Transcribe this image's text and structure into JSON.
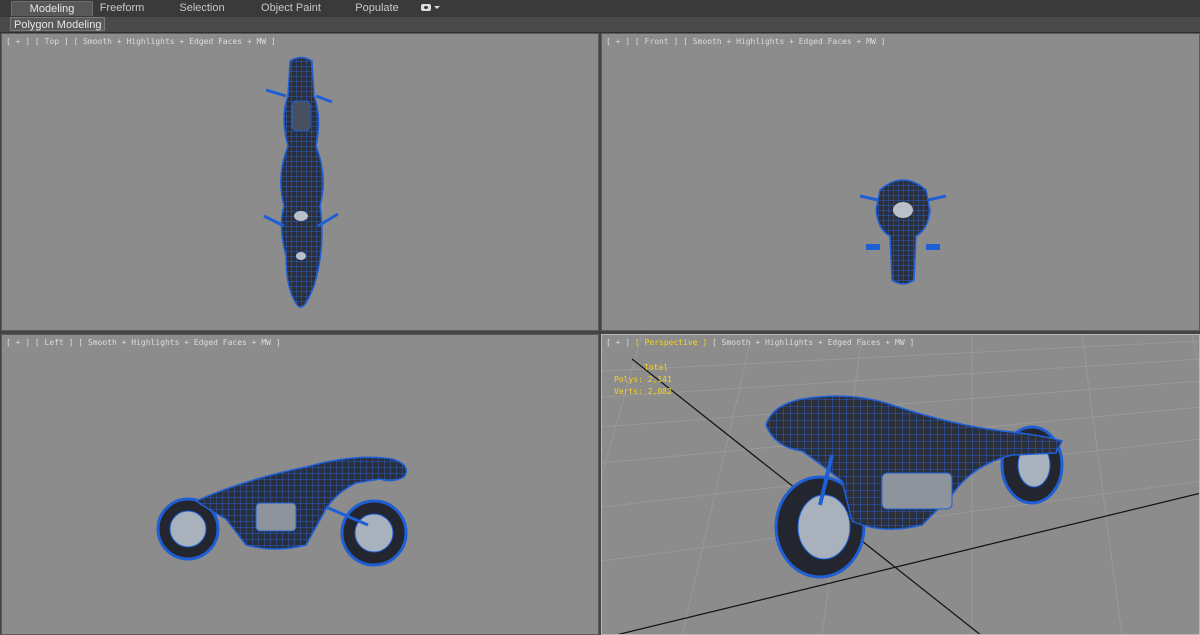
{
  "ribbon": {
    "tabs": [
      {
        "label": "Modeling",
        "active": true
      },
      {
        "label": "Freeform",
        "active": false
      },
      {
        "label": "Selection",
        "active": false
      },
      {
        "label": "Object Paint",
        "active": false
      },
      {
        "label": "Populate",
        "active": false
      }
    ],
    "options_icon": "camera-dropdown-icon",
    "panel_label": "Polygon Modeling"
  },
  "viewports": {
    "top": {
      "plus": "[ + ]",
      "name": "[ Top ]",
      "shading": "[ Smooth + Highlights + Edged Faces + MW ]"
    },
    "front": {
      "plus": "[ + ]",
      "name": "[ Front ]",
      "shading": "[ Smooth + Highlights + Edged Faces + MW ]"
    },
    "left": {
      "plus": "[ + ]",
      "name": "[ Left ]",
      "shading": "[ Smooth + Highlights + Edged Faces + MW ]"
    },
    "perspective": {
      "plus": "[ + ]",
      "name": "[ Perspective ]",
      "shading": "[ Smooth + Highlights + Edged Faces + MW ]",
      "stats": {
        "header": "Total",
        "polys_label": "Polys:",
        "polys_value": "2,141",
        "verts_label": "Verts:",
        "verts_value": "2,082"
      }
    }
  },
  "colors": {
    "viewport_bg": "#8c8c8c",
    "wire_blue": "#1f5fd6",
    "highlight_label": "#f4d41e"
  },
  "objects": {
    "model": "motorcycle-wireframe-icon"
  }
}
